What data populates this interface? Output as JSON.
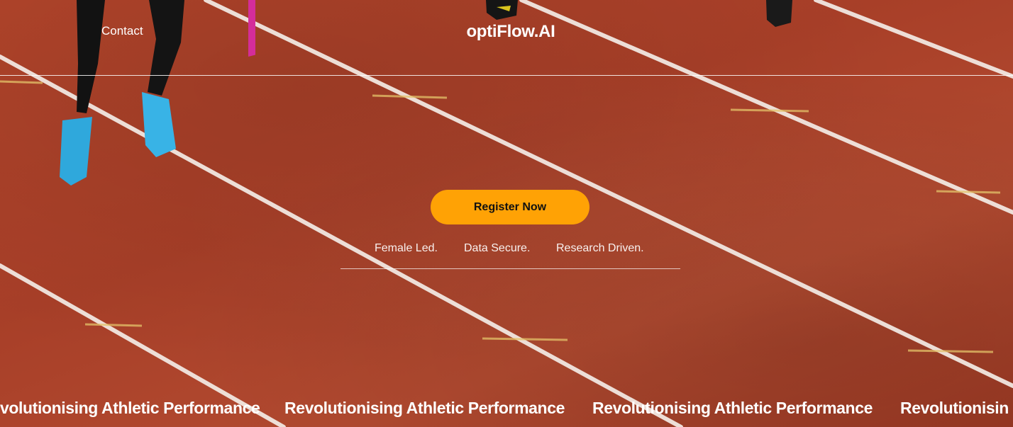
{
  "nav": {
    "contact_label": "Contact",
    "brand": "optiFlow.AI"
  },
  "hero": {
    "cta_label": "Register Now",
    "tags": [
      "Female Led.",
      "Data Secure.",
      "Research Driven."
    ]
  },
  "marquee": {
    "text_visible_start": "volutionising Athletic Performance",
    "text": "Revolutionising Athletic Performance",
    "text_visible_end": "Revolutionisin"
  },
  "colors": {
    "track": "#b4452b",
    "cta": "#ffa205",
    "text": "#ffffff"
  }
}
